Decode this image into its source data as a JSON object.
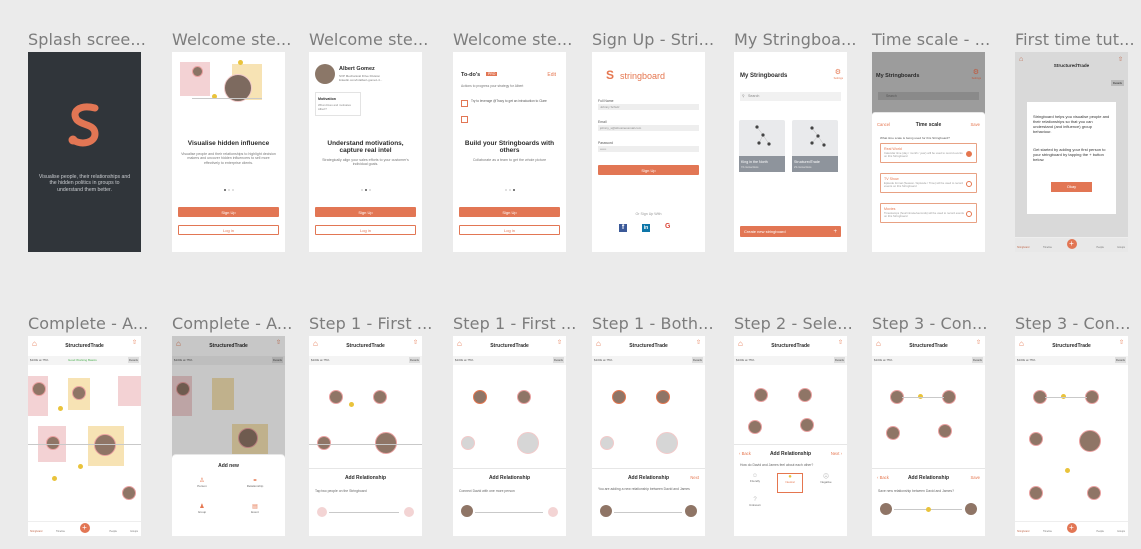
{
  "frames": [
    {
      "title": "Splash scree...",
      "splash_text": "Visualise people, their relationships and the hidden politics in groups to understand them better."
    },
    {
      "title": "Welcome ste...",
      "heading": "Visualise hidden influence",
      "desc": "Visualise people and their relationships to highlight decision makers and uncover hidden influencers to sell more effectively to enterprise clients.",
      "signup": "Sign Up",
      "login": "Log in"
    },
    {
      "title": "Welcome ste...",
      "person_name": "Albert Gomez",
      "person_role": "SVP Mechanical Drive Division",
      "person_link": "linkedin.com/in/albert-gomez-4...",
      "motivation": "Motivation",
      "motivation_q": "What drives and motivates Albert?",
      "heading": "Understand motivations, capture real intel",
      "desc": "Strategically align your sales efforts to your customer's individual goals.",
      "signup": "Sign Up",
      "login": "Log in"
    },
    {
      "title": "Welcome ste...",
      "todo": "To-do's",
      "todo_badge": "PRO",
      "edit": "Edit",
      "todo_desc": "Actions to progress your strategy for Albert",
      "task1": "Try to leverage @Tracy to get an introduction to Clare",
      "heading": "Build your Stringboards with others",
      "desc": "Collaborate as a team to get the whole picture",
      "signup": "Sign Up",
      "login": "Log in"
    },
    {
      "title": "Sign Up - Stri...",
      "brand": "stringboard",
      "full_name_label": "Full Name",
      "full_name_value": "Johnny Schulz",
      "email_label": "Email",
      "email_value": "johnny_s@stbusinessmail.com",
      "password_label": "Password",
      "password_value": "••••••",
      "signup": "Sign Up",
      "or": "Or Sign Up With"
    },
    {
      "title": "My Stringboa...",
      "heading": "My Stringboards",
      "settings": "Settings",
      "search": "Search",
      "board1": "King in the North",
      "board1_meta": "72 connections",
      "board2": "StructuredTrade",
      "board2_meta": "23 connections",
      "create": "Create new stringboard"
    },
    {
      "title": "Time scale - ...",
      "heading": "My Stringboards",
      "settings": "Settings",
      "search": "Search",
      "cancel": "Cancel",
      "sheet_title": "Time scale",
      "save": "Save",
      "question": "What time scale is being used for this Stringboard?",
      "opt1": "Real World",
      "opt1_desc": "Calendar time (day / month / year) will be used to record events on this Stringboard",
      "opt2": "TV Show",
      "opt2_desc": "Episode format (Season / Episode / Time) will be used to record events on this Stringboard",
      "opt3": "Movies",
      "opt3_desc": "Timestamps (hour/minute/seconds) will be used to record events on this Stringboard"
    },
    {
      "title": "First time tut...",
      "app_title": "StructuredTrade",
      "details": "Details",
      "tut_text": "Stringboard helps you visualise people and their relationships so that you can understand (and influence) group behaviour.",
      "tut_text2": "Get started by adding your first person to your stringboard by tapping the + button below.",
      "okay": "Okay",
      "tabs": [
        "Stringboard",
        "Timeline",
        "",
        "People",
        "Groups"
      ]
    },
    {
      "title": "Complete - A...",
      "app_title": "StructuredTrade",
      "tabs": [
        "Stringboard",
        "Timeline",
        "",
        "People",
        "Groups"
      ]
    },
    {
      "title": "Complete - A...",
      "app_title": "StructuredTrade",
      "add_new": "Add new",
      "opt_person": "Person",
      "opt_relationship": "Relationship",
      "opt_group": "Group",
      "opt_event": "Event"
    },
    {
      "title": "Step 1 - First ...",
      "app_title": "StructuredTrade",
      "sheet_title": "Add Relationship",
      "sheet_sub": "Tap two people on the Stringboard"
    },
    {
      "title": "Step 1 - First ...",
      "app_title": "StructuredTrade",
      "sheet_title": "Add Relationship",
      "sheet_sub": "Connect David with one more person"
    },
    {
      "title": "Step 1 - Both...",
      "app_title": "StructuredTrade",
      "sheet_title": "Add Relationship",
      "next": "Next",
      "sheet_sub": "You are adding a new relationship between David and James"
    },
    {
      "title": "Step 2 - Sele...",
      "app_title": "StructuredTrade",
      "back": "Back",
      "sheet_title": "Add Relationship",
      "next": "Next",
      "question": "How do David and James feel about each other?",
      "opts": [
        "Friendly",
        "Neutral",
        "Negative",
        "Unknown"
      ]
    },
    {
      "title": "Step 3 - Con...",
      "app_title": "StructuredTrade",
      "back": "Back",
      "sheet_title": "Add Relationship",
      "save": "Save",
      "sheet_sub": "Save new relationship between David and James?"
    },
    {
      "title": "Step 3 - Con...",
      "app_title": "StructuredTrade",
      "tabs": [
        "Stringboard",
        "Timeline",
        "",
        "People",
        "Groups"
      ]
    }
  ],
  "common": {
    "search_label": "Search",
    "share_label": "Share",
    "status_budget": "$100k at 75%",
    "status_stage": "Good Working Basics",
    "details": "Details"
  },
  "colors": {
    "canvas": "#ebebeb",
    "accent": "#e27654",
    "dark": "#30353a",
    "yellow": "#e9c33b"
  }
}
